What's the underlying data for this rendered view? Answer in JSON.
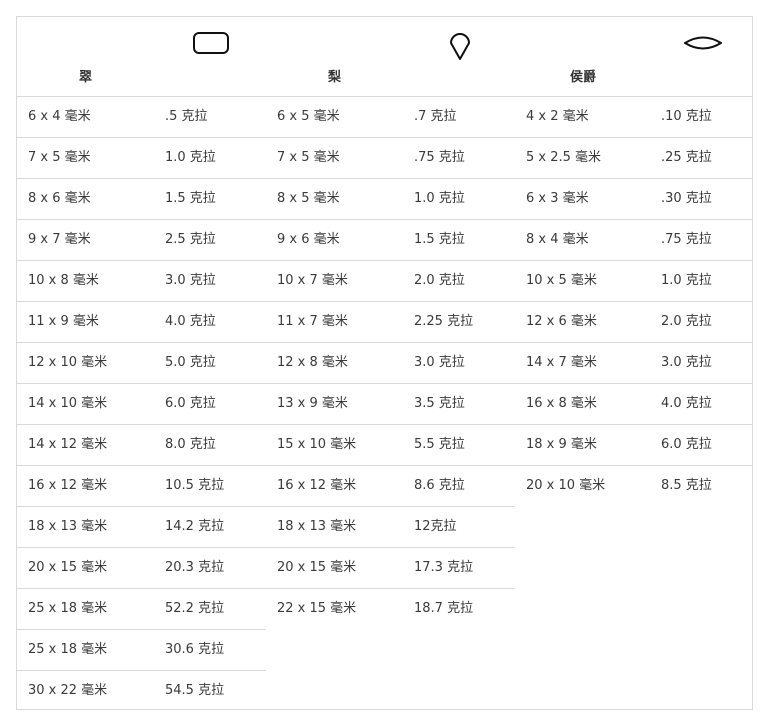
{
  "table": {
    "groups": [
      {
        "name": "翠",
        "shape_icon": "rounded-rectangle-outline",
        "rows": [
          {
            "size": "6 x 4 毫米",
            "weight": ".5 克拉"
          },
          {
            "size": "7 x 5 毫米",
            "weight": "1.0 克拉"
          },
          {
            "size": "8 x 6 毫米",
            "weight": "1.5 克拉"
          },
          {
            "size": "9 x 7 毫米",
            "weight": "2.5 克拉"
          },
          {
            "size": "10 x 8 毫米",
            "weight": "3.0 克拉"
          },
          {
            "size": "11 x 9 毫米",
            "weight": "4.0 克拉"
          },
          {
            "size": "12 x 10 毫米",
            "weight": "5.0 克拉"
          },
          {
            "size": "14 x 10 毫米",
            "weight": "6.0 克拉"
          },
          {
            "size": "14 x 12 毫米",
            "weight": "8.0 克拉"
          },
          {
            "size": "16 x 12 毫米",
            "weight": "10.5 克拉"
          },
          {
            "size": "18 x 13 毫米",
            "weight": "14.2 克拉"
          },
          {
            "size": "20 x 15 毫米",
            "weight": "20.3 克拉"
          },
          {
            "size": "25 x 18 毫米",
            "weight": "52.2 克拉"
          },
          {
            "size": "25 x 18 毫米",
            "weight": "30.6 克拉"
          },
          {
            "size": "30 x 22 毫米",
            "weight": "54.5 克拉"
          }
        ]
      },
      {
        "name": "梨",
        "shape_icon": "pear-teardrop-outline",
        "rows": [
          {
            "size": "6 x 5 毫米",
            "weight": ".7 克拉"
          },
          {
            "size": "7 x 5 毫米",
            "weight": ".75 克拉"
          },
          {
            "size": "8 x 5 毫米",
            "weight": "1.0 克拉"
          },
          {
            "size": "9 x 6 毫米",
            "weight": "1.5 克拉"
          },
          {
            "size": "10 x 7 毫米",
            "weight": "2.0 克拉"
          },
          {
            "size": "11 x 7 毫米",
            "weight": "2.25 克拉"
          },
          {
            "size": "12 x 8 毫米",
            "weight": "3.0 克拉"
          },
          {
            "size": "13 x 9 毫米",
            "weight": "3.5 克拉"
          },
          {
            "size": "15 x 10 毫米",
            "weight": "5.5 克拉"
          },
          {
            "size": "16 x 12 毫米",
            "weight": "8.6 克拉"
          },
          {
            "size": "18 x 13 毫米",
            "weight": "12克拉"
          },
          {
            "size": "20 x 15 毫米",
            "weight": "17.3 克拉"
          },
          {
            "size": "22 x 15 毫米",
            "weight": "18.7 克拉"
          }
        ]
      },
      {
        "name": "侯爵",
        "shape_icon": "marquise-ellipse-outline",
        "rows": [
          {
            "size": "4 x 2 毫米",
            "weight": ".10 克拉"
          },
          {
            "size": "5 x 2.5 毫米",
            "weight": ".25 克拉"
          },
          {
            "size": "6 x 3 毫米",
            "weight": ".30 克拉"
          },
          {
            "size": "8 x 4 毫米",
            "weight": ".75 克拉"
          },
          {
            "size": "10 x 5 毫米",
            "weight": "1.0 克拉"
          },
          {
            "size": "12 x 6 毫米",
            "weight": "2.0 克拉"
          },
          {
            "size": "14 x 7 毫米",
            "weight": "3.0 克拉"
          },
          {
            "size": "16 x 8 毫米",
            "weight": "4.0 克拉"
          },
          {
            "size": "18 x 9 毫米",
            "weight": "6.0 克拉"
          },
          {
            "size": "20 x 10 毫米",
            "weight": "8.5 克拉"
          }
        ]
      }
    ]
  }
}
